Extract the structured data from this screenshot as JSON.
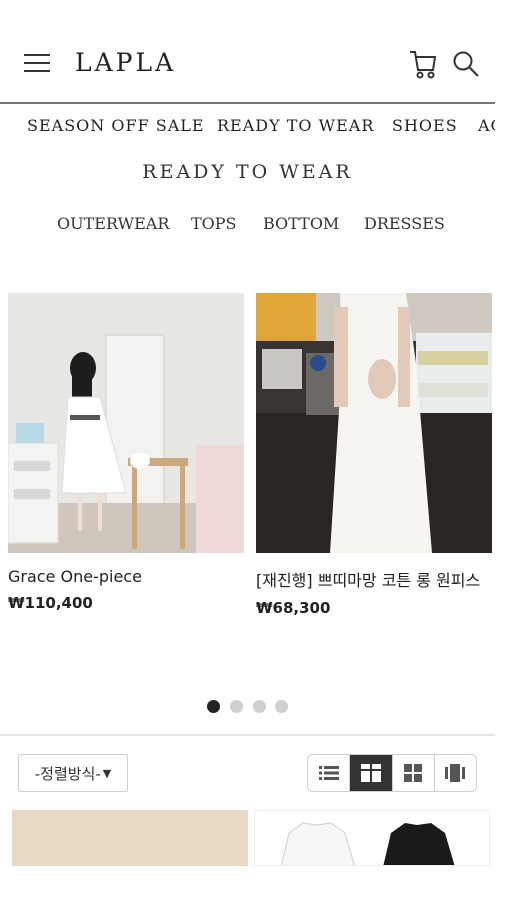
{
  "header": {
    "logo": "LAPLA",
    "menu_icon": "hamburger-menu-icon",
    "cart_icon": "cart-icon",
    "search_icon": "search-icon"
  },
  "category_nav": [
    "SEASON OFF SALE",
    "READY TO WEAR",
    "SHOES",
    "AC"
  ],
  "section": {
    "title": "READY TO WEAR",
    "subcategories": [
      "OUTERWEAR",
      "TOPS",
      "BOTTOM",
      "DRESSES"
    ]
  },
  "products": [
    {
      "name": "Grace One-piece",
      "price": "₩110,400"
    },
    {
      "name": "[재진행] 쁘띠마망 코튼 롱 원피스",
      "price": "₩68,300"
    }
  ],
  "carousel": {
    "pages": 4,
    "active": 1
  },
  "sort": {
    "label": "-정렬방식-"
  },
  "view_options": [
    "list-view-icon",
    "grid-large-icon",
    "grid-small-icon",
    "gallery-view-icon"
  ],
  "view_active": 1,
  "colors": {
    "dark": "#222222",
    "dot_inactive": "#cfcfcf",
    "border": "#cfcfcf"
  }
}
